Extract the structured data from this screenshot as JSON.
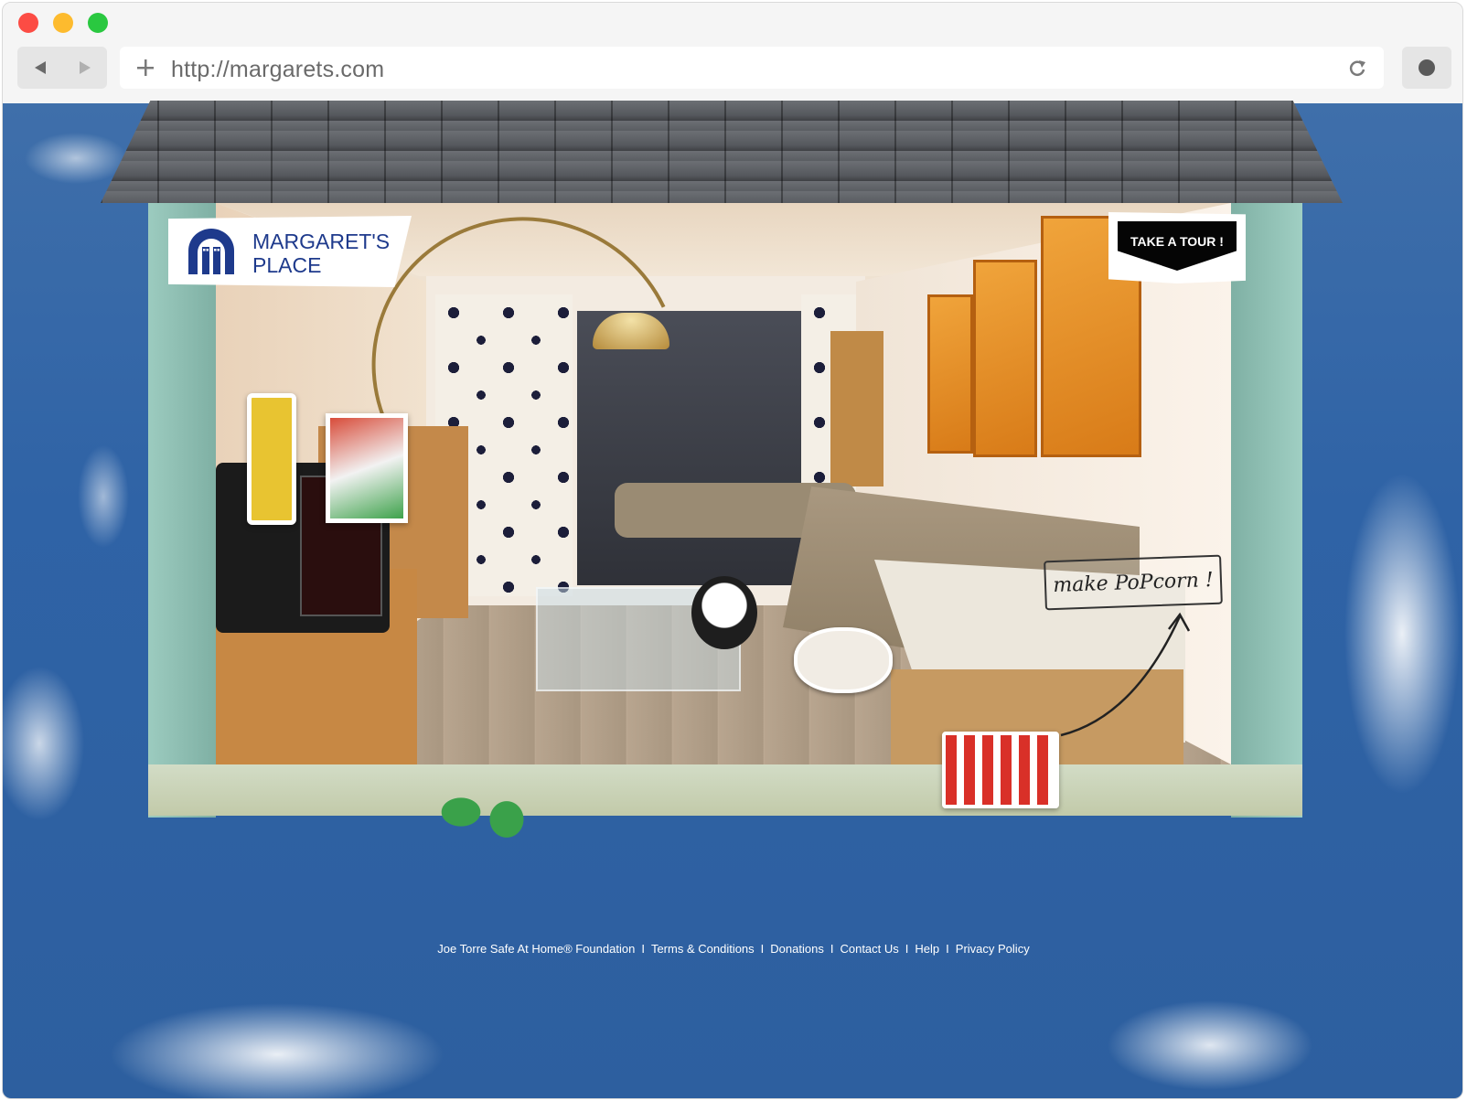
{
  "browser": {
    "url": "http://margarets.com",
    "traffic_lights": {
      "close": "#fc4c44",
      "minimize": "#fdbb2e",
      "maximize": "#2ac840"
    }
  },
  "site": {
    "logo_line1": "MARGARET'S",
    "logo_line2": "PLACE",
    "tour_button": "TAKE A TOUR !",
    "popcorn_cta": "make PoPcorn !",
    "footer_links": [
      "Joe Torre Safe At Home® Foundation",
      "Terms & Conditions",
      "Donations",
      "Contact Us",
      "Help",
      "Privacy Policy"
    ],
    "footer_separator": "I",
    "colors": {
      "brand_blue": "#1e3a8c",
      "sky": "#2f63a6",
      "wall_mint": "#8fbeb2"
    }
  }
}
